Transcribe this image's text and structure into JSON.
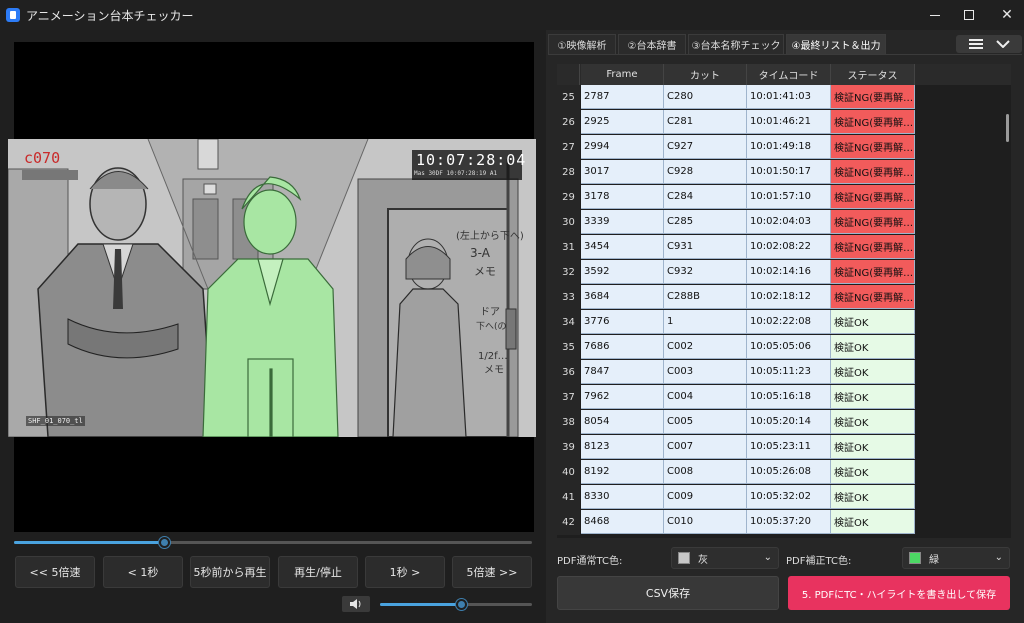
{
  "window": {
    "title": "アニメーション台本チェッカー"
  },
  "video": {
    "cut_label": "c070",
    "timecode": "10:07:28:04",
    "timecode_sub": "Mas  30DF    10:07:28:19 A1",
    "file_label": "SHF_01_070_tl",
    "seek_progress": 0.29,
    "volume_level": 0.53
  },
  "controls": [
    {
      "label": "<< 5倍速"
    },
    {
      "label": "< 1秒"
    },
    {
      "label": "5秒前から再生"
    },
    {
      "label": "再生/停止"
    },
    {
      "label": "1秒 >"
    },
    {
      "label": "5倍速 >>"
    }
  ],
  "tabs": [
    {
      "label": "①映像解析",
      "active": false
    },
    {
      "label": "②台本辞書",
      "active": false
    },
    {
      "label": "③台本名称チェック",
      "active": false
    },
    {
      "label": "④最終リスト＆出力",
      "active": true
    }
  ],
  "table": {
    "columns": [
      "Frame",
      "カット",
      "タイムコード",
      "ステータス"
    ],
    "rows": [
      {
        "n": "25",
        "frame": "2787",
        "cut": "C280",
        "tc": "10:01:41:03",
        "status": "検証NG(要再解…",
        "ok": false
      },
      {
        "n": "26",
        "frame": "2925",
        "cut": "C281",
        "tc": "10:01:46:21",
        "status": "検証NG(要再解…",
        "ok": false
      },
      {
        "n": "27",
        "frame": "2994",
        "cut": "C927",
        "tc": "10:01:49:18",
        "status": "検証NG(要再解…",
        "ok": false
      },
      {
        "n": "28",
        "frame": "3017",
        "cut": "C928",
        "tc": "10:01:50:17",
        "status": "検証NG(要再解…",
        "ok": false
      },
      {
        "n": "29",
        "frame": "3178",
        "cut": "C284",
        "tc": "10:01:57:10",
        "status": "検証NG(要再解…",
        "ok": false
      },
      {
        "n": "30",
        "frame": "3339",
        "cut": "C285",
        "tc": "10:02:04:03",
        "status": "検証NG(要再解…",
        "ok": false
      },
      {
        "n": "31",
        "frame": "3454",
        "cut": "C931",
        "tc": "10:02:08:22",
        "status": "検証NG(要再解…",
        "ok": false
      },
      {
        "n": "32",
        "frame": "3592",
        "cut": "C932",
        "tc": "10:02:14:16",
        "status": "検証NG(要再解…",
        "ok": false
      },
      {
        "n": "33",
        "frame": "3684",
        "cut": "C288B",
        "tc": "10:02:18:12",
        "status": "検証NG(要再解…",
        "ok": false
      },
      {
        "n": "34",
        "frame": "3776",
        "cut": "1",
        "tc": "10:02:22:08",
        "status": "検証OK",
        "ok": true
      },
      {
        "n": "35",
        "frame": "7686",
        "cut": "C002",
        "tc": "10:05:05:06",
        "status": "検証OK",
        "ok": true
      },
      {
        "n": "36",
        "frame": "7847",
        "cut": "C003",
        "tc": "10:05:11:23",
        "status": "検証OK",
        "ok": true
      },
      {
        "n": "37",
        "frame": "7962",
        "cut": "C004",
        "tc": "10:05:16:18",
        "status": "検証OK",
        "ok": true
      },
      {
        "n": "38",
        "frame": "8054",
        "cut": "C005",
        "tc": "10:05:20:14",
        "status": "検証OK",
        "ok": true
      },
      {
        "n": "39",
        "frame": "8123",
        "cut": "C007",
        "tc": "10:05:23:11",
        "status": "検証OK",
        "ok": true
      },
      {
        "n": "40",
        "frame": "8192",
        "cut": "C008",
        "tc": "10:05:26:08",
        "status": "検証OK",
        "ok": true
      },
      {
        "n": "41",
        "frame": "8330",
        "cut": "C009",
        "tc": "10:05:32:02",
        "status": "検証OK",
        "ok": true
      },
      {
        "n": "42",
        "frame": "8468",
        "cut": "C010",
        "tc": "10:05:37:20",
        "status": "検証OK",
        "ok": true
      }
    ]
  },
  "pdf_options": {
    "normal_label": "PDF通常TC色:",
    "normal_value": "灰",
    "normal_color": "#c8c8c8",
    "fixed_label": "PDF補正TC色:",
    "fixed_value": "緑",
    "fixed_color": "#4cd964"
  },
  "buttons": {
    "csv": "CSV保存",
    "pdf": "5. PDFにTC・ハイライトを書き出して保存"
  },
  "colors": {
    "ng": "#f25b5b",
    "ok": "#e6fae6",
    "accent": "#e8335f",
    "seek": "#4aa3df"
  }
}
